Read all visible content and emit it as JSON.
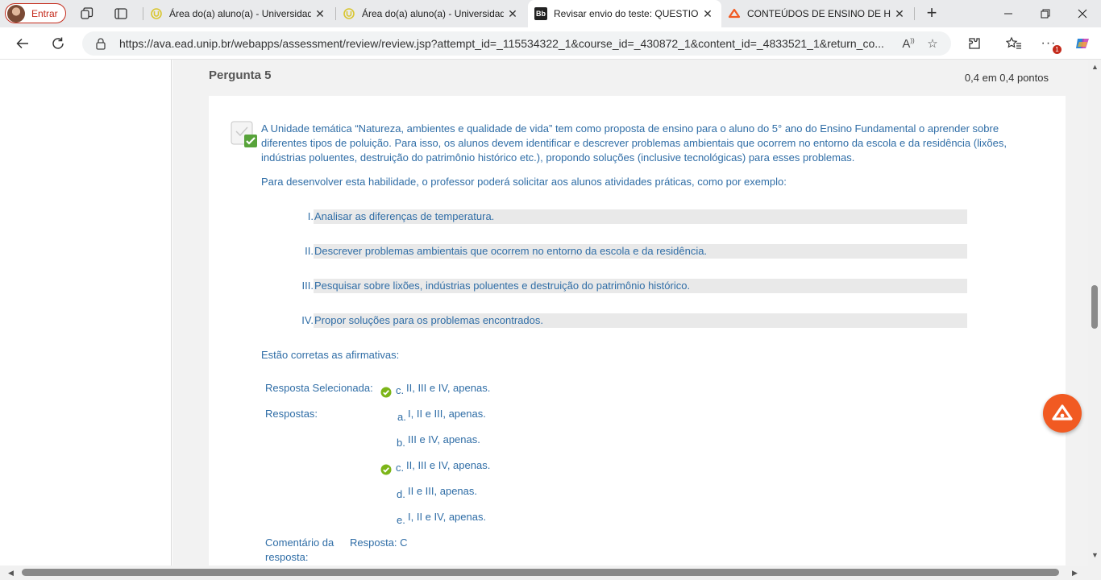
{
  "browser": {
    "profile_label": "Entrar",
    "tabs": [
      {
        "title": "Área do(a) aluno(a) - Universidade",
        "favicon": "unip-icon"
      },
      {
        "title": "Área do(a) aluno(a) - Universidade",
        "favicon": "unip-icon"
      },
      {
        "title": "Revisar envio do teste: QUESTION",
        "favicon": "blackboard-icon",
        "favicon_text": "Bb"
      },
      {
        "title": "CONTEÚDOS DE ENSINO DE HIST",
        "favicon": "orange-brand-icon"
      }
    ],
    "url": "https://ava.ead.unip.br/webapps/assessment/review/review.jsp?attempt_id=_115534322_1&course_id=_430872_1&content_id=_4833521_1&return_co...",
    "notification_count": "1"
  },
  "question": {
    "title": "Pergunta 5",
    "points": "0,4 em 0,4 pontos",
    "text": "A Unidade temática “Natureza, ambientes e qualidade de vida” tem como proposta de ensino para o aluno do 5° ano do Ensino Fundamental o aprender sobre diferentes tipos de poluição. Para isso, os alunos devem identificar e descrever problemas ambientais que ocorrem no entorno da escola e da residência (lixões, indústrias poluentes, destruição do patrimônio histórico etc.), propondo soluções (inclusive tecnológicas) para esses problemas.",
    "prompt": "Para desenvolver esta habilidade, o professor poderá solicitar aos alunos atividades práticas, como por exemplo:",
    "items": [
      {
        "num": "I.",
        "text": "Analisar as diferenças de temperatura."
      },
      {
        "num": "II.",
        "text": "Descrever problemas ambientais que ocorrem no entorno da escola e da residência."
      },
      {
        "num": "III.",
        "text": "Pesquisar sobre lixões, indústrias poluentes e destruição do patrimônio histórico."
      },
      {
        "num": "IV.",
        "text": "Propor soluções para os problemas encontrados."
      }
    ],
    "ask": "Estão corretas as afirmativas:",
    "selected_label": "Resposta Selecionada:",
    "selected": {
      "letter": "c.",
      "text": "II, III e IV, apenas."
    },
    "answers_label": "Respostas:",
    "answers": [
      {
        "letter": "a.",
        "text": "I, II e III, apenas."
      },
      {
        "letter": "b.",
        "text": "III e IV, apenas."
      },
      {
        "letter": "c.",
        "text": "II, III e IV, apenas."
      },
      {
        "letter": "d.",
        "text": "II e III, apenas."
      },
      {
        "letter": "e.",
        "text": "I, II e IV, apenas."
      }
    ],
    "feedback_label_1": "Comentário da",
    "feedback_label_2": "resposta:",
    "feedback_answer": "Resposta: C"
  },
  "colors": {
    "accent_blue": "#2f6da6",
    "correct_green": "#7cb518",
    "fab_orange": "#f15a22"
  }
}
